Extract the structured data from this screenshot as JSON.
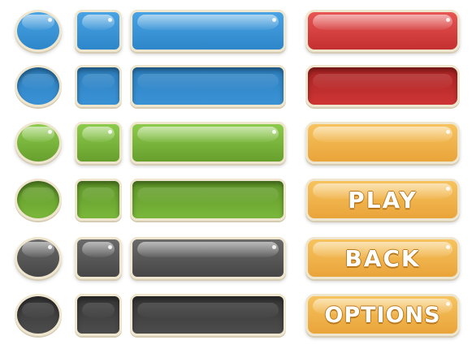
{
  "colors": {
    "blue": "#3a93d6",
    "blue_dark": "#2a7ab8",
    "green": "#7ab83b",
    "green_dark": "#5f9a28",
    "gray": "#555555",
    "gray_dark": "#3d3d3d",
    "red": "#d63b3b",
    "red_dark": "#b52828",
    "orange": "#f0b24a",
    "border": "#efe6cf"
  },
  "buttons": {
    "play_label": "PLAY",
    "back_label": "BACK",
    "options_label": "OPTIONS"
  }
}
